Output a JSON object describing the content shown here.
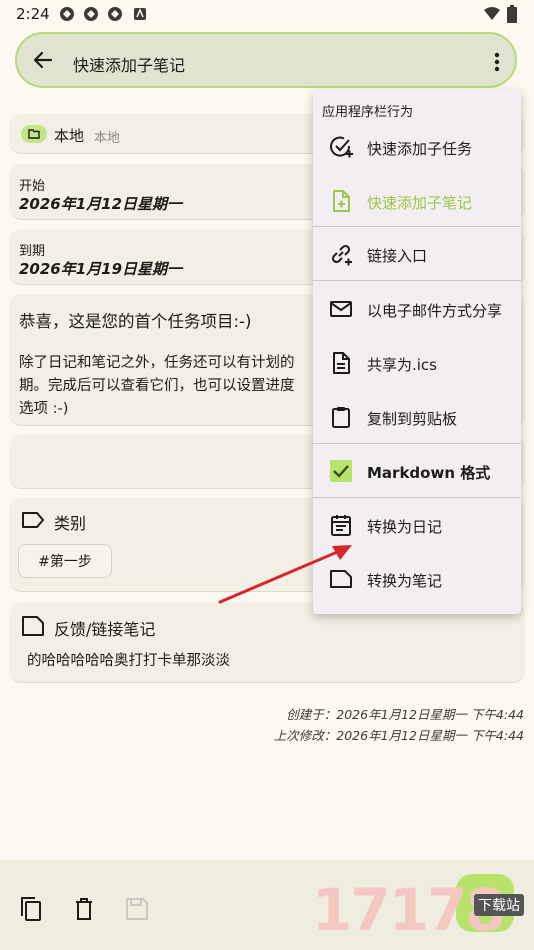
{
  "status_bar": {
    "time": "2:24"
  },
  "top_bar": {
    "title": "快速添加子笔记"
  },
  "collection": {
    "name": "本地",
    "sub": "本地"
  },
  "start": {
    "label": "开始",
    "date": "2026年1月12日星期一"
  },
  "due": {
    "label": "到期",
    "date": "2026年1月19日星期一"
  },
  "description": {
    "title": "恭喜，这是您的首个任务项目:-)",
    "line1": "除了日记和笔记之外，任务还可以有计划的",
    "line2": "期。完成后可以查看它们，也可以设置进度",
    "line3": "选项 :-)"
  },
  "categories": {
    "title": "类别",
    "chip": "#第一步"
  },
  "feedback": {
    "title": "反馈/链接笔记",
    "text": "的哈哈哈哈哈奥打打卡单那淡淡"
  },
  "footer": {
    "created": "创建于：2026年1月12日星期一 下午4:44",
    "modified": "上次修改：2026年1月12日星期一 下午4:44"
  },
  "menu": {
    "header": "应用程序栏行为",
    "items": [
      {
        "label": "快速添加子任务",
        "icon": "add-task-icon"
      },
      {
        "label": "快速添加子笔记",
        "icon": "add-note-icon"
      },
      {
        "label": "链接入口",
        "icon": "add-link-icon"
      },
      {
        "label": "以电子邮件方式分享",
        "icon": "mail-icon"
      },
      {
        "label": "共享为.ics",
        "icon": "file-icon"
      },
      {
        "label": "复制到剪贴板",
        "icon": "clipboard-icon"
      },
      {
        "label": "Markdown 格式",
        "icon": "checkbox-icon"
      },
      {
        "label": "转换为日记",
        "icon": "calendar-icon"
      },
      {
        "label": "转换为笔记",
        "icon": "note-icon"
      }
    ]
  },
  "watermark": {
    "number": "17178",
    "tag": "下载站"
  },
  "colors": {
    "accent": "#b8e36a",
    "accent_text": "#9bc84a",
    "menu_bg": "#f2eef2"
  }
}
